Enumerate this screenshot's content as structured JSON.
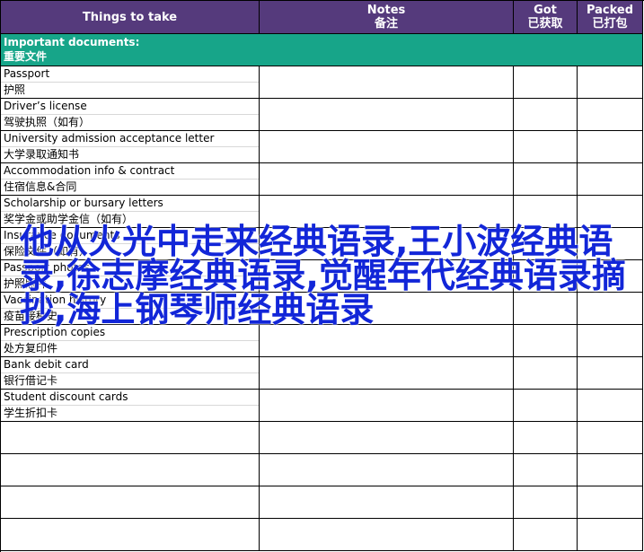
{
  "headers": {
    "col1": "Things to take",
    "col2_en": "Notes",
    "col2_zh": "备注",
    "col3_en": "Got",
    "col3_zh": "已获取",
    "col4_en": "Packed",
    "col4_zh": "已打包"
  },
  "section": {
    "title_en": "Important documents:",
    "title_zh": "重要文件"
  },
  "items": [
    {
      "en": "Passport",
      "zh": "护照"
    },
    {
      "en": "Driver’s license",
      "zh": "驾驶执照（如有）"
    },
    {
      "en": "University admission acceptance letter",
      "zh": "大学录取通知书"
    },
    {
      "en": "Accommodation info & contract",
      "zh": "住宿信息&合同"
    },
    {
      "en": "Scholarship or bursary letters",
      "zh": "奖学金或助学金信（如有）"
    },
    {
      "en": "Insurance documents",
      "zh": "保险文件（如有）"
    },
    {
      "en": "Passport photos",
      "zh": "护照照片"
    },
    {
      "en": "Vaccination history",
      "zh": "疫苗接种史"
    },
    {
      "en": "Prescription copies",
      "zh": "处方复印件"
    },
    {
      "en": "Bank debit card",
      "zh": "银行借记卡"
    },
    {
      "en": "Student discount cards",
      "zh": "学生折扣卡"
    }
  ],
  "overlay_text": "他从火光中走来经典语录,王小波经典语录,徐志摩经典语录,觉醒年代经典语录摘抄,海上钢琴师经典语录",
  "colors": {
    "header_bg": "#553a7c",
    "section_bg": "#17a589",
    "overlay_text": "#1226d8"
  }
}
